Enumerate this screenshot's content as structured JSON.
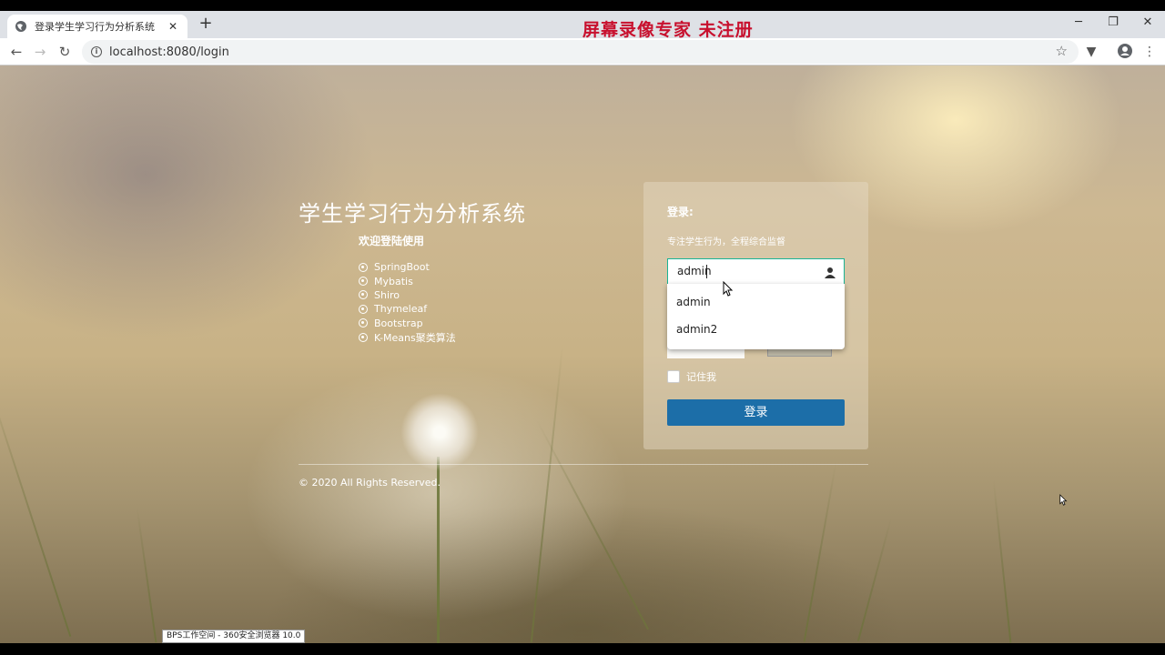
{
  "browser": {
    "tab_title": "登录学生学习行为分析系统",
    "tab_close": "✕",
    "new_tab": "+",
    "url": "localhost:8080/login",
    "watermark": "屏幕录像专家  未注册",
    "status_text": "BPS工作空间 - 360安全浏览器 10.0"
  },
  "intro": {
    "system_title": "学生学习行为分析系统",
    "welcome": "欢迎登陆使用",
    "tech_stack": [
      "SpringBoot",
      "Mybatis",
      "Shiro",
      "Thymeleaf",
      "Bootstrap",
      "K-Means聚类算法"
    ]
  },
  "login": {
    "heading": "登录:",
    "subtitle": "专注学生行为，全程综合监督",
    "username_value": "admin",
    "suggestions": [
      "admin",
      "admin2"
    ],
    "remember_label": "记住我",
    "submit_label": "登录"
  },
  "footer": {
    "copyright": "© 2020 All Rights Reserved."
  },
  "colors": {
    "accent_button": "#1c6ea8",
    "input_focus_border": "#1ab394",
    "watermark": "#c8102e"
  }
}
